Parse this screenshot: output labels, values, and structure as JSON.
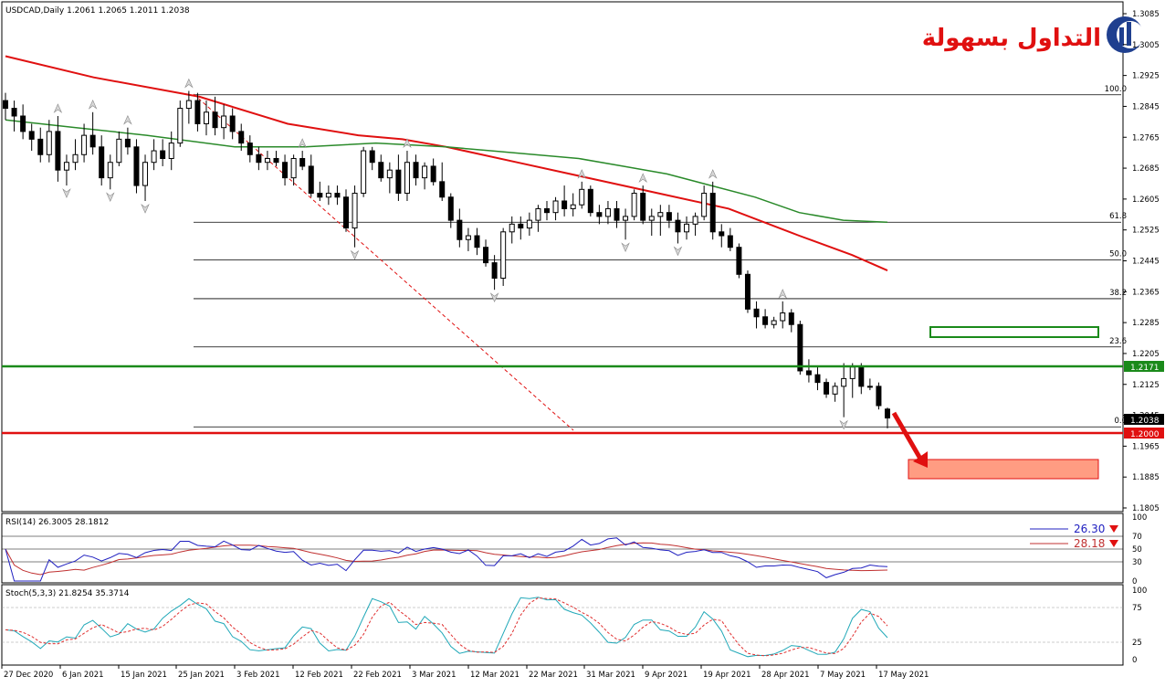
{
  "colors": {
    "bg": "#ffffff",
    "grid_frame": "#000000",
    "ema_slow": "#e01010",
    "ema_fast": "#2a8a2a",
    "support_line": "#e01010",
    "resistance_line": "#1a8a1a",
    "rsi_line": "#2020c0",
    "rsi_signal": "#c03030",
    "stoch_main": "#20a8b8",
    "stoch_signal": "#e03030",
    "target_box_fill": "#ff9c82",
    "target_box_stroke": "#e01010",
    "green_box_stroke": "#1a8a1a",
    "logo_text": "#e01010",
    "logo_icon": "#1f3f8f"
  },
  "header": {
    "title": "USDCAD,Daily  1.2061 1.2065 1.2011 1.2038"
  },
  "logo": {
    "text": "التداول بسهولة",
    "icon": "bar-chart-logo-icon"
  },
  "price_axis": {
    "ticks": [
      "1.3085",
      "1.3005",
      "1.2925",
      "1.2845",
      "1.2765",
      "1.2685",
      "1.2605",
      "1.2525",
      "1.2445",
      "1.2365",
      "1.2285",
      "1.2205",
      "1.2125",
      "1.2045",
      "1.1965",
      "1.1885",
      "1.1805"
    ],
    "current_price": "1.2038",
    "green_level": "1.2171",
    "red_level": "1.2000"
  },
  "fib_levels": [
    {
      "label": "100.0",
      "price": 1.2875
    },
    {
      "label": "61.8",
      "price": 1.2545
    },
    {
      "label": "50.0",
      "price": 1.2447
    },
    {
      "label": "38.2",
      "price": 1.2347
    },
    {
      "label": "23.6",
      "price": 1.2222
    },
    {
      "label": "0.0",
      "price": 1.2015
    }
  ],
  "date_axis": {
    "labels": [
      "27 Dec 2020",
      "6 Jan 2021",
      "15 Jan 2021",
      "25 Jan 2021",
      "3 Feb 2021",
      "12 Feb 2021",
      "22 Feb 2021",
      "3 Mar 2021",
      "12 Mar 2021",
      "22 Mar 2021",
      "31 Mar 2021",
      "9 Apr 2021",
      "19 Apr 2021",
      "28 Apr 2021",
      "7 May 2021",
      "17 May 2021"
    ]
  },
  "rsi": {
    "title": "RSI(14) 26.3005 28.1812",
    "legend": [
      {
        "name": "26.30",
        "color": "#2020c0"
      },
      {
        "name": "28.18",
        "color": "#c03030"
      }
    ],
    "ticks": [
      "100",
      "70",
      "50",
      "30",
      "0"
    ]
  },
  "stoch": {
    "title": "Stoch(5,3,3) 21.8254 35.3714",
    "ticks": [
      "100",
      "75",
      "25",
      "0"
    ]
  },
  "chart_data": {
    "type": "candlestick",
    "symbol": "USDCAD",
    "timeframe": "Daily",
    "ohlc_last": {
      "open": 1.2061,
      "high": 1.2065,
      "low": 1.2011,
      "close": 1.2038
    },
    "ylim": [
      1.1805,
      1.3085
    ],
    "candles": [
      [
        1.286,
        1.288,
        1.281,
        1.284
      ],
      [
        1.284,
        1.286,
        1.278,
        1.282
      ],
      [
        1.282,
        1.285,
        1.276,
        1.278
      ],
      [
        1.278,
        1.28,
        1.273,
        1.276
      ],
      [
        1.276,
        1.279,
        1.27,
        1.272
      ],
      [
        1.272,
        1.281,
        1.27,
        1.278
      ],
      [
        1.278,
        1.282,
        1.265,
        1.268
      ],
      [
        1.268,
        1.272,
        1.264,
        1.27
      ],
      [
        1.27,
        1.276,
        1.268,
        1.272
      ],
      [
        1.272,
        1.28,
        1.27,
        1.277
      ],
      [
        1.277,
        1.283,
        1.272,
        1.274
      ],
      [
        1.274,
        1.277,
        1.264,
        1.266
      ],
      [
        1.266,
        1.272,
        1.263,
        1.27
      ],
      [
        1.27,
        1.278,
        1.269,
        1.276
      ],
      [
        1.276,
        1.279,
        1.272,
        1.274
      ],
      [
        1.274,
        1.276,
        1.262,
        1.264
      ],
      [
        1.264,
        1.272,
        1.26,
        1.27
      ],
      [
        1.27,
        1.276,
        1.268,
        1.273
      ],
      [
        1.273,
        1.276,
        1.269,
        1.271
      ],
      [
        1.271,
        1.278,
        1.268,
        1.275
      ],
      [
        1.275,
        1.286,
        1.274,
        1.284
      ],
      [
        1.284,
        1.2885,
        1.28,
        1.286
      ],
      [
        1.286,
        1.288,
        1.278,
        1.28
      ],
      [
        1.28,
        1.286,
        1.277,
        1.283
      ],
      [
        1.283,
        1.287,
        1.277,
        1.279
      ],
      [
        1.279,
        1.285,
        1.276,
        1.282
      ],
      [
        1.282,
        1.284,
        1.276,
        1.278
      ],
      [
        1.278,
        1.28,
        1.273,
        1.275
      ],
      [
        1.275,
        1.277,
        1.27,
        1.272
      ],
      [
        1.272,
        1.274,
        1.268,
        1.27
      ],
      [
        1.27,
        1.273,
        1.268,
        1.271
      ],
      [
        1.271,
        1.273,
        1.269,
        1.27
      ],
      [
        1.27,
        1.272,
        1.264,
        1.266
      ],
      [
        1.266,
        1.272,
        1.264,
        1.271
      ],
      [
        1.271,
        1.273,
        1.268,
        1.269
      ],
      [
        1.269,
        1.272,
        1.261,
        1.262
      ],
      [
        1.262,
        1.265,
        1.26,
        1.261
      ],
      [
        1.261,
        1.264,
        1.259,
        1.262
      ],
      [
        1.262,
        1.264,
        1.259,
        1.261
      ],
      [
        1.261,
        1.263,
        1.252,
        1.253
      ],
      [
        1.253,
        1.264,
        1.248,
        1.262
      ],
      [
        1.262,
        1.274,
        1.261,
        1.273
      ],
      [
        1.273,
        1.274,
        1.268,
        1.27
      ],
      [
        1.27,
        1.272,
        1.265,
        1.266
      ],
      [
        1.266,
        1.27,
        1.262,
        1.268
      ],
      [
        1.268,
        1.272,
        1.26,
        1.262
      ],
      [
        1.262,
        1.273,
        1.26,
        1.27
      ],
      [
        1.27,
        1.272,
        1.264,
        1.266
      ],
      [
        1.266,
        1.27,
        1.263,
        1.269
      ],
      [
        1.269,
        1.271,
        1.264,
        1.265
      ],
      [
        1.265,
        1.27,
        1.26,
        1.261
      ],
      [
        1.261,
        1.262,
        1.253,
        1.255
      ],
      [
        1.255,
        1.258,
        1.248,
        1.25
      ],
      [
        1.25,
        1.253,
        1.247,
        1.251
      ],
      [
        1.251,
        1.253,
        1.246,
        1.248
      ],
      [
        1.248,
        1.25,
        1.243,
        1.244
      ],
      [
        1.244,
        1.246,
        1.237,
        1.24
      ],
      [
        1.24,
        1.253,
        1.238,
        1.252
      ],
      [
        1.252,
        1.256,
        1.249,
        1.254
      ],
      [
        1.254,
        1.256,
        1.25,
        1.253
      ],
      [
        1.253,
        1.257,
        1.251,
        1.255
      ],
      [
        1.255,
        1.259,
        1.252,
        1.258
      ],
      [
        1.258,
        1.26,
        1.255,
        1.257
      ],
      [
        1.257,
        1.261,
        1.255,
        1.26
      ],
      [
        1.26,
        1.264,
        1.256,
        1.258
      ],
      [
        1.258,
        1.262,
        1.256,
        1.259
      ],
      [
        1.259,
        1.265,
        1.258,
        1.263
      ],
      [
        1.263,
        1.264,
        1.256,
        1.257
      ],
      [
        1.257,
        1.259,
        1.254,
        1.256
      ],
      [
        1.256,
        1.26,
        1.254,
        1.258
      ],
      [
        1.258,
        1.26,
        1.253,
        1.255
      ],
      [
        1.255,
        1.258,
        1.25,
        1.256
      ],
      [
        1.256,
        1.263,
        1.255,
        1.262
      ],
      [
        1.262,
        1.264,
        1.254,
        1.255
      ],
      [
        1.255,
        1.258,
        1.251,
        1.256
      ],
      [
        1.256,
        1.259,
        1.251,
        1.257
      ],
      [
        1.257,
        1.259,
        1.253,
        1.255
      ],
      [
        1.255,
        1.257,
        1.249,
        1.252
      ],
      [
        1.252,
        1.256,
        1.25,
        1.254
      ],
      [
        1.254,
        1.257,
        1.251,
        1.256
      ],
      [
        1.256,
        1.264,
        1.255,
        1.262
      ],
      [
        1.262,
        1.265,
        1.25,
        1.252
      ],
      [
        1.252,
        1.254,
        1.248,
        1.251
      ],
      [
        1.251,
        1.253,
        1.247,
        1.248
      ],
      [
        1.248,
        1.249,
        1.24,
        1.241
      ],
      [
        1.241,
        1.242,
        1.231,
        1.232
      ],
      [
        1.232,
        1.234,
        1.227,
        1.23
      ],
      [
        1.23,
        1.232,
        1.227,
        1.228
      ],
      [
        1.228,
        1.23,
        1.227,
        1.229
      ],
      [
        1.229,
        1.234,
        1.227,
        1.231
      ],
      [
        1.231,
        1.232,
        1.226,
        1.228
      ],
      [
        1.228,
        1.229,
        1.215,
        1.216
      ],
      [
        1.216,
        1.219,
        1.213,
        1.215
      ],
      [
        1.215,
        1.217,
        1.211,
        1.213
      ],
      [
        1.213,
        1.214,
        1.209,
        1.21
      ],
      [
        1.21,
        1.213,
        1.208,
        1.212
      ],
      [
        1.212,
        1.218,
        1.204,
        1.214
      ],
      [
        1.214,
        1.218,
        1.209,
        1.217
      ],
      [
        1.217,
        1.218,
        1.21,
        1.212
      ],
      [
        1.212,
        1.214,
        1.211,
        1.212
      ],
      [
        1.212,
        1.213,
        1.206,
        1.207
      ],
      [
        1.2061,
        1.2065,
        1.2011,
        1.2038
      ]
    ],
    "ema_fast_pts": [
      [
        1.281,
        0
      ],
      [
        1.279,
        8
      ],
      [
        1.277,
        16
      ],
      [
        1.274,
        26
      ],
      [
        1.274,
        34
      ],
      [
        1.275,
        42
      ],
      [
        1.274,
        50
      ],
      [
        1.273,
        55
      ],
      [
        1.272,
        60
      ],
      [
        1.271,
        65
      ],
      [
        1.269,
        70
      ],
      [
        1.267,
        75
      ],
      [
        1.264,
        80
      ],
      [
        1.261,
        85
      ],
      [
        1.257,
        90
      ],
      [
        1.255,
        95
      ],
      [
        1.2545,
        100
      ]
    ],
    "ema_slow_pts": [
      [
        1.2975,
        0
      ],
      [
        1.292,
        10
      ],
      [
        1.287,
        22
      ],
      [
        1.28,
        32
      ],
      [
        1.277,
        40
      ],
      [
        1.276,
        45
      ],
      [
        1.274,
        50
      ],
      [
        1.27,
        58
      ],
      [
        1.266,
        66
      ],
      [
        1.262,
        74
      ],
      [
        1.258,
        82
      ],
      [
        1.251,
        90
      ],
      [
        1.246,
        96
      ],
      [
        1.242,
        100
      ]
    ],
    "target_price_zone": [
      1.19,
      1.193
    ],
    "resistance_zone": [
      1.2265,
      1.2285
    ]
  }
}
